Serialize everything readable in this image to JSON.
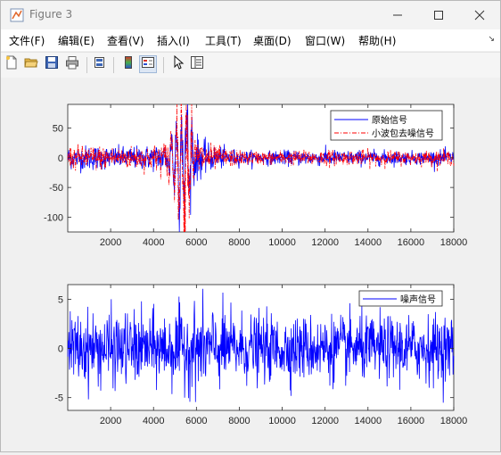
{
  "window": {
    "title": "Figure 3",
    "icon": "matlab-figure-icon",
    "controls": [
      "minimize-icon",
      "maximize-icon",
      "close-icon"
    ]
  },
  "menubar": {
    "items": [
      {
        "label": "文件(F)"
      },
      {
        "label": "编辑(E)"
      },
      {
        "label": "查看(V)"
      },
      {
        "label": "插入(I)"
      },
      {
        "label": "工具(T)"
      },
      {
        "label": "桌面(D)"
      },
      {
        "label": "窗口(W)"
      },
      {
        "label": "帮助(H)"
      }
    ],
    "corner_glyph": "↘"
  },
  "toolbar": {
    "buttons": [
      "new-figure-icon",
      "open-folder-icon",
      "save-icon",
      "print-icon",
      "link-plot-icon",
      "colorbar-icon",
      "legend-icon",
      "pointer-icon",
      "property-inspector-icon"
    ]
  },
  "chart_data": [
    {
      "type": "line",
      "title": "",
      "xlabel": "",
      "ylabel": "",
      "xlim": [
        0,
        18000
      ],
      "ylim": [
        -125,
        90
      ],
      "xticks": [
        2000,
        4000,
        6000,
        8000,
        10000,
        12000,
        14000,
        16000,
        18000
      ],
      "yticks": [
        50,
        0,
        -50,
        -100
      ],
      "grid": false,
      "legend_position": "top-right",
      "series": [
        {
          "name": "原始信号",
          "color": "#0000ff",
          "style": "solid"
        },
        {
          "name": "小波包去噪信号",
          "color": "#ff0000",
          "style": "dash-dot"
        }
      ],
      "envelope": {
        "x": [
          0,
          1000,
          2000,
          3000,
          4000,
          4700,
          5000,
          5200,
          5400,
          5500,
          5700,
          6000,
          6500,
          7000,
          8000,
          9000,
          10000,
          11000,
          12000,
          13000,
          14000,
          15000,
          16000,
          17000,
          18000
        ],
        "amplitude": [
          22,
          25,
          22,
          22,
          25,
          35,
          60,
          75,
          110,
          120,
          65,
          45,
          28,
          22,
          15,
          13,
          14,
          15,
          16,
          14,
          15,
          14,
          13,
          14,
          15
        ]
      }
    },
    {
      "type": "line",
      "title": "",
      "xlabel": "",
      "ylabel": "",
      "xlim": [
        0,
        18000
      ],
      "ylim": [
        -6.3,
        6.5
      ],
      "xticks": [
        2000,
        4000,
        6000,
        8000,
        10000,
        12000,
        14000,
        16000,
        18000
      ],
      "yticks": [
        5,
        0,
        -5
      ],
      "grid": false,
      "legend_position": "top-right",
      "series": [
        {
          "name": "噪声信号",
          "color": "#0000ff",
          "style": "solid"
        }
      ],
      "envelope": {
        "x": [
          0,
          2000,
          4000,
          5000,
          6000,
          7000,
          8000,
          10000,
          12000,
          14000,
          16000,
          18000
        ],
        "amplitude": [
          4.5,
          4.8,
          4.6,
          5.0,
          5.6,
          5.2,
          4.5,
          4.2,
          4.3,
          4.2,
          4.3,
          4.4
        ]
      }
    }
  ]
}
